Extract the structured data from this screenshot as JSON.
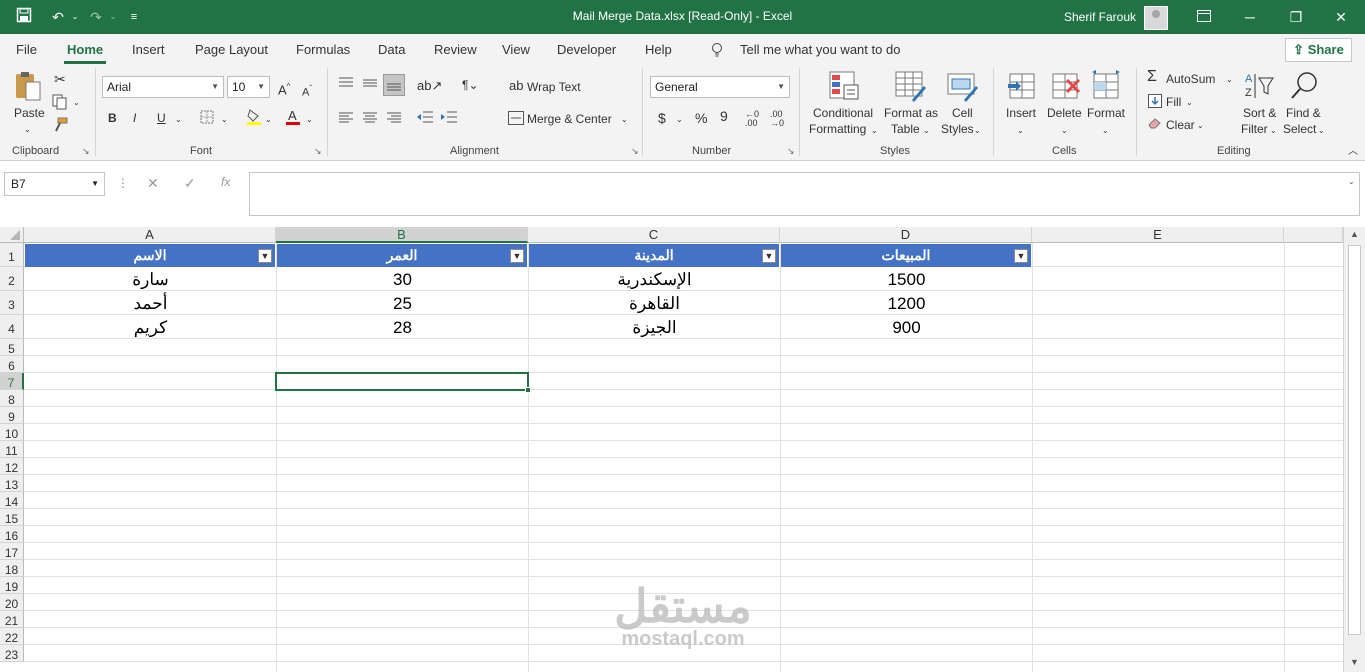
{
  "titlebar": {
    "title": "Mail Merge Data.xlsx  [Read-Only]  -  Excel",
    "user": "Sherif Farouk"
  },
  "tabs": [
    "File",
    "Home",
    "Insert",
    "Page Layout",
    "Formulas",
    "Data",
    "Review",
    "View",
    "Developer",
    "Help"
  ],
  "tell_me": "Tell me what you want to do",
  "share_label": "Share",
  "ribbon": {
    "clipboard": {
      "paste": "Paste",
      "group": "Clipboard"
    },
    "font": {
      "name": "Arial",
      "size": "10",
      "group": "Font",
      "bold": "B",
      "italic": "I",
      "underline": "U"
    },
    "alignment": {
      "wrap": "Wrap Text",
      "merge": "Merge & Center",
      "group": "Alignment"
    },
    "number": {
      "format": "General",
      "currency": "$",
      "percent": "%",
      "comma": "9",
      "group": "Number"
    },
    "styles": {
      "cond_1": "Conditional",
      "cond_2": "Formatting",
      "fmt_1": "Format as",
      "fmt_2": "Table",
      "cell_1": "Cell",
      "cell_2": "Styles",
      "group": "Styles"
    },
    "cells": {
      "insert": "Insert",
      "delete": "Delete",
      "format": "Format",
      "group": "Cells"
    },
    "editing": {
      "autosum": "AutoSum",
      "fill": "Fill",
      "clear": "Clear",
      "sort_1": "Sort &",
      "sort_2": "Filter",
      "find_1": "Find &",
      "find_2": "Select",
      "group": "Editing"
    }
  },
  "formula_bar": {
    "name_box": "B7",
    "fx": "fx",
    "value": ""
  },
  "sheet": {
    "columns": [
      "A",
      "B",
      "C",
      "D",
      "E"
    ],
    "rows": [
      "1",
      "2",
      "3",
      "4",
      "5",
      "6",
      "7",
      "8",
      "9",
      "10",
      "11",
      "12",
      "13",
      "14",
      "15",
      "16",
      "17",
      "18",
      "19",
      "20",
      "21",
      "22",
      "23"
    ],
    "headers": [
      "الاسم",
      "العمر",
      "المدينة",
      "المبيعات"
    ],
    "data": [
      [
        "سارة",
        "30",
        "الإسكندرية",
        "1500"
      ],
      [
        "أحمد",
        "25",
        "القاهرة",
        "1200"
      ],
      [
        "كريم",
        "28",
        "الجيزة",
        "900"
      ]
    ],
    "active_cell": "B7"
  },
  "watermark": {
    "arabic": "مستقل",
    "latin": "mostaql.com"
  },
  "colors": {
    "accent": "#217346",
    "table_header": "#4472c4"
  }
}
